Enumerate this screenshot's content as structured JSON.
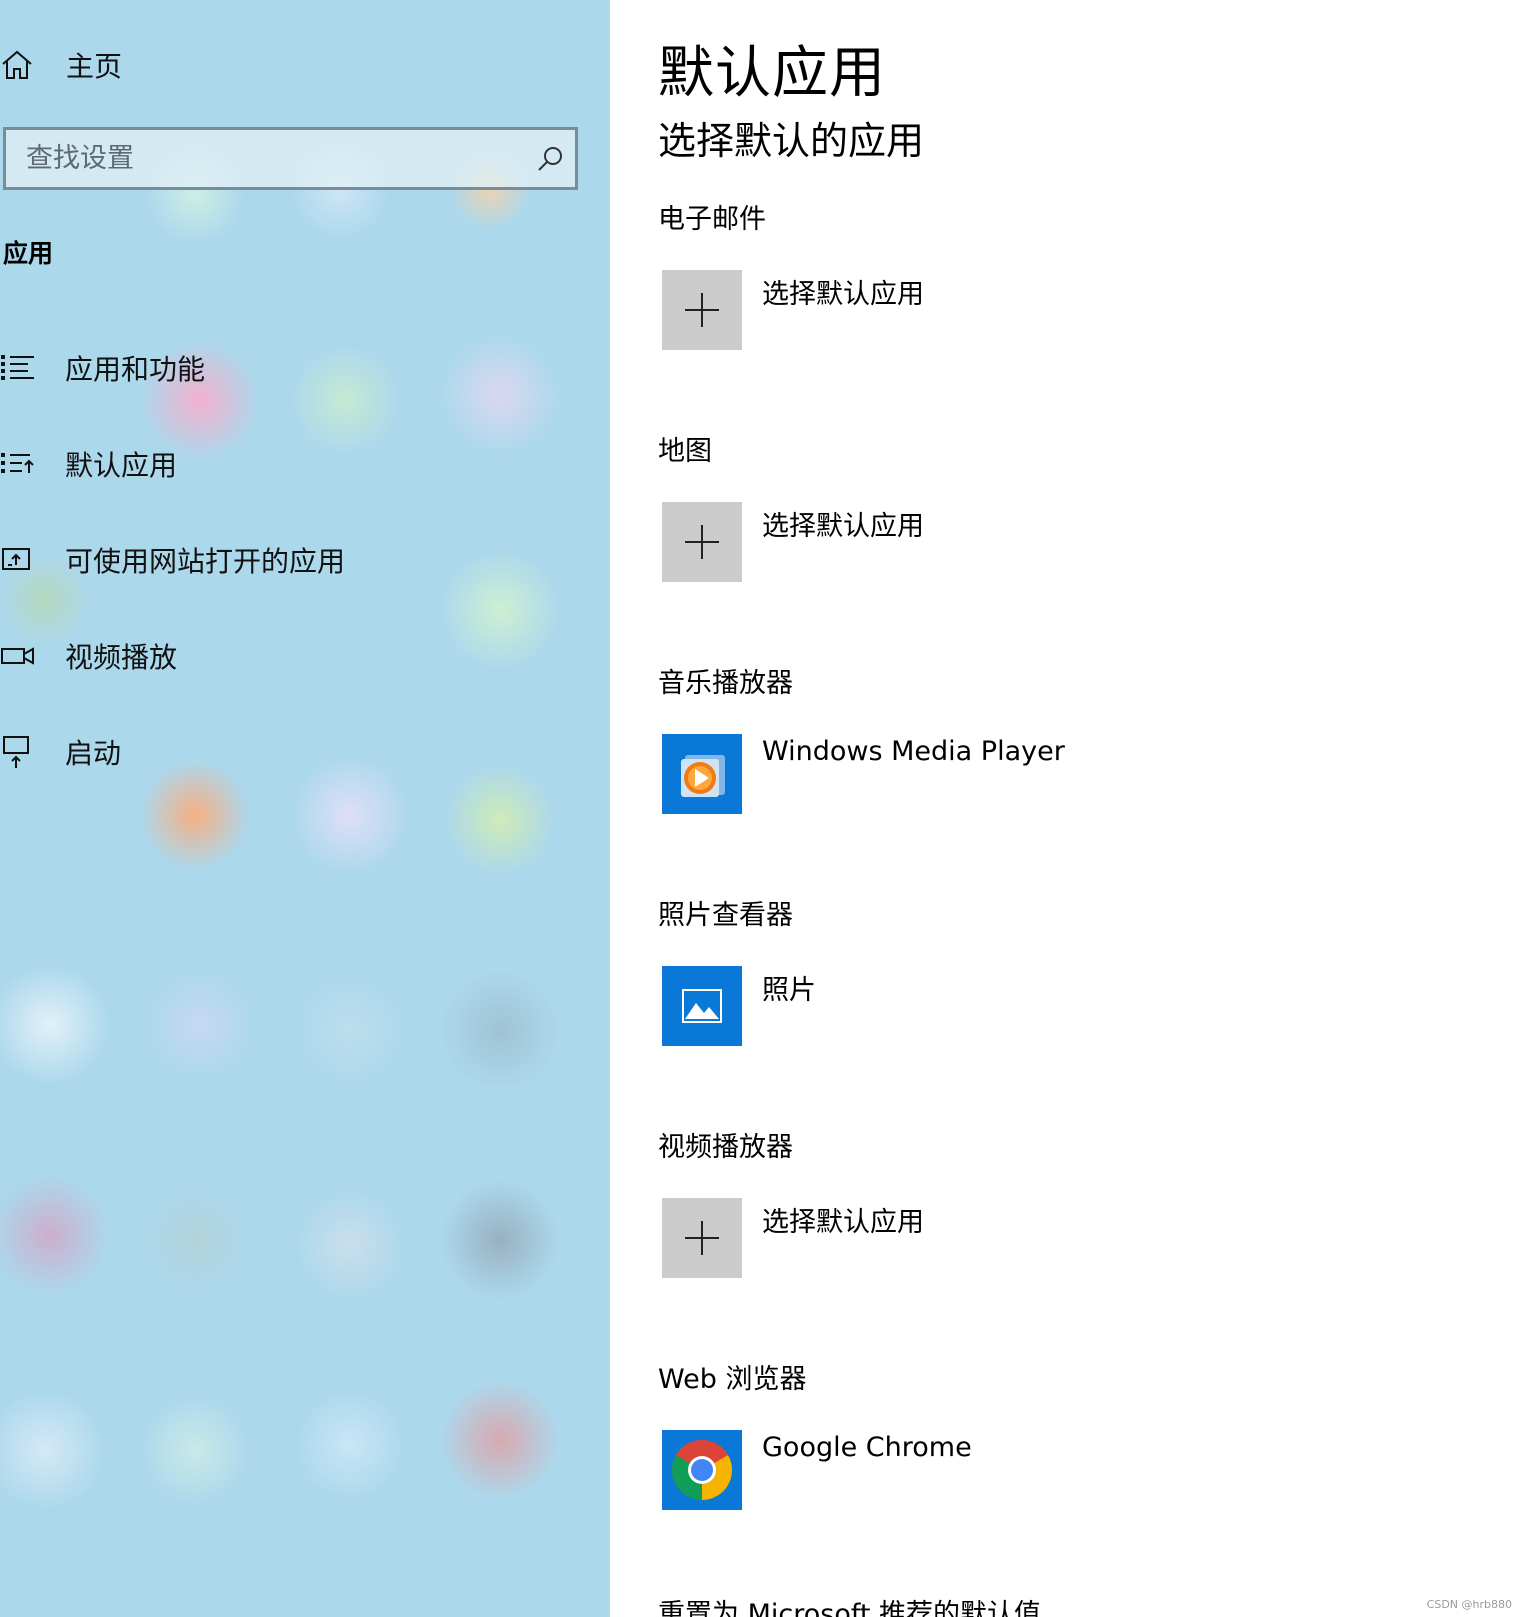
{
  "sidebar": {
    "home_label": "主页",
    "search_placeholder": "查找设置",
    "section_title": "应用",
    "items": [
      {
        "label": "应用和功能",
        "icon": "apps-features-icon"
      },
      {
        "label": "默认应用",
        "icon": "default-apps-icon"
      },
      {
        "label": "可使用网站打开的应用",
        "icon": "apps-for-websites-icon"
      },
      {
        "label": "视频播放",
        "icon": "video-playback-icon"
      },
      {
        "label": "启动",
        "icon": "startup-icon"
      }
    ]
  },
  "main": {
    "title": "默认应用",
    "subtitle": "选择默认的应用",
    "categories": [
      {
        "label": "电子邮件",
        "app": "选择默认应用",
        "icon": "plus-icon"
      },
      {
        "label": "地图",
        "app": "选择默认应用",
        "icon": "plus-icon"
      },
      {
        "label": "音乐播放器",
        "app": "Windows Media Player",
        "icon": "windows-media-player-icon"
      },
      {
        "label": "照片查看器",
        "app": "照片",
        "icon": "photos-icon"
      },
      {
        "label": "视频播放器",
        "app": "选择默认应用",
        "icon": "plus-icon"
      },
      {
        "label": "Web 浏览器",
        "app": "Google Chrome",
        "icon": "google-chrome-icon"
      }
    ],
    "reset_label": "重置为 Microsoft 推荐的默认值"
  },
  "watermark": "CSDN @hrb880",
  "colors": {
    "sidebar_bg": "#acd8ec",
    "tile_blue": "#0a78d7",
    "tile_gray": "#cccccc"
  }
}
